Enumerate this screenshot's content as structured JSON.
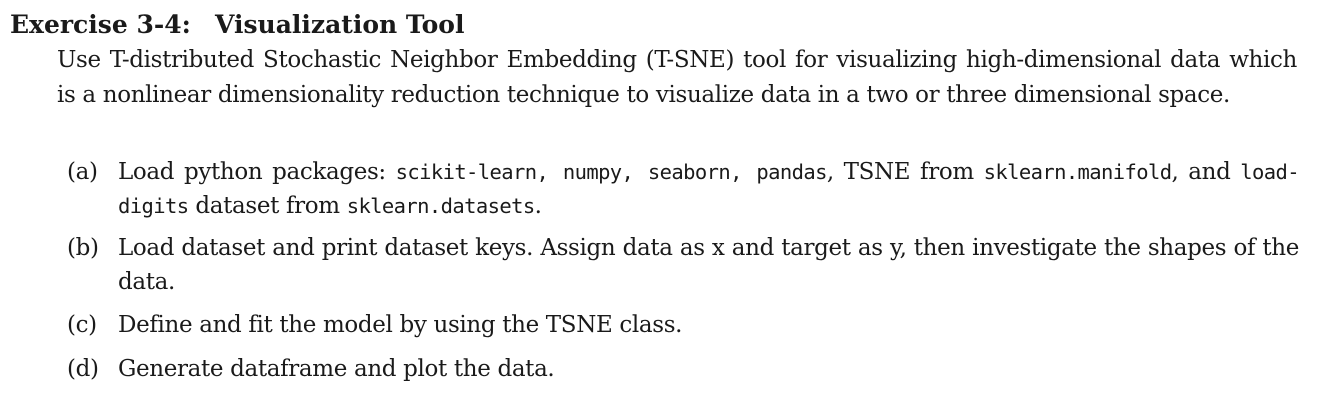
{
  "exercise": {
    "label": "Exercise 3-4:",
    "title": "Visualization Tool"
  },
  "intro": "Use T-distributed Stochastic Neighbor Embedding (T-SNE) tool for visualizing high-dimensional data which is a nonlinear dimensionality reduction technique to visualize data in a two or three dimensional space.",
  "items": [
    {
      "marker": "(a)",
      "parts": {
        "t1": "Load python packages: ",
        "c1": "scikit-learn, numpy, seaborn, pandas",
        "t2": ", TSNE from ",
        "c2": "sklearn.manifold",
        "t3": ", and ",
        "c3": "load-digits",
        "t4": " dataset from ",
        "c4": "sklearn.datasets",
        "t5": "."
      }
    },
    {
      "marker": "(b)",
      "text": "Load dataset and print dataset keys. Assign data as x and target as y, then investigate the shapes of the data."
    },
    {
      "marker": "(c)",
      "text": "Define and fit the model by using the TSNE class."
    },
    {
      "marker": "(d)",
      "text": "Generate dataframe and plot the data."
    }
  ]
}
